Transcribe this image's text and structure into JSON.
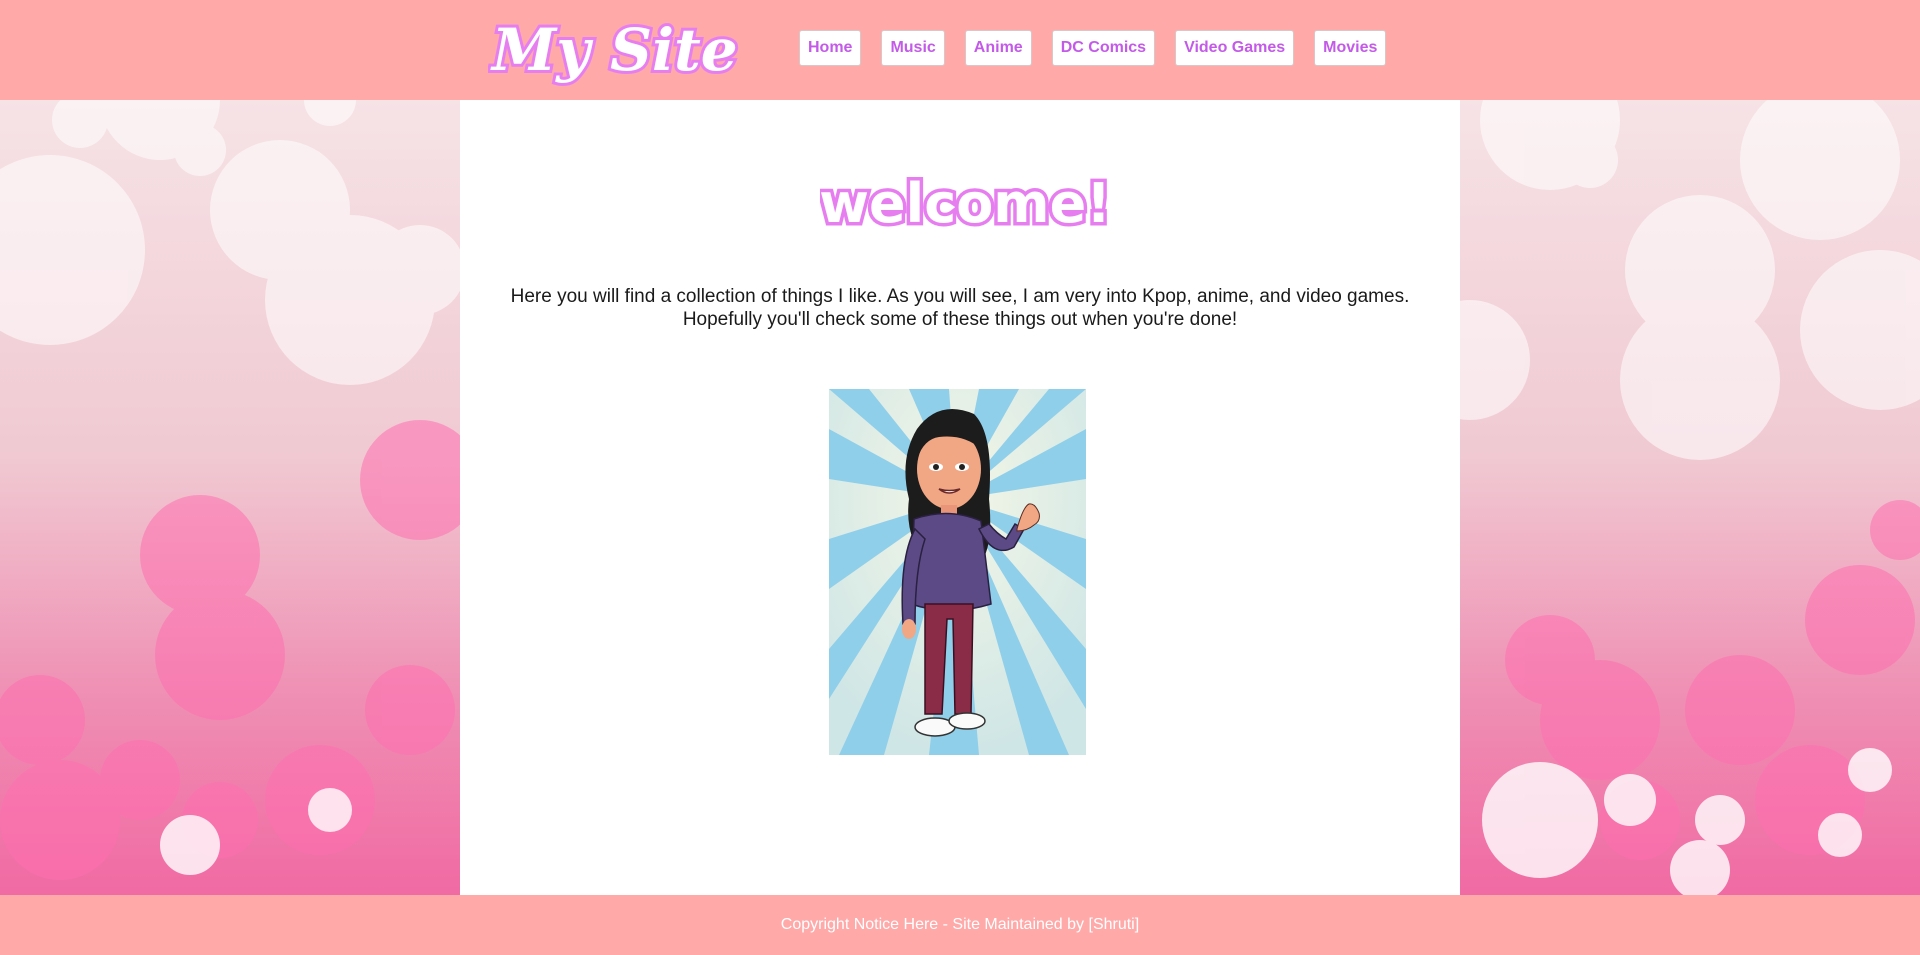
{
  "header": {
    "logo_text": "My Site",
    "nav": [
      {
        "label": "Home"
      },
      {
        "label": "Music"
      },
      {
        "label": "Anime"
      },
      {
        "label": "DC Comics"
      },
      {
        "label": "Video Games"
      },
      {
        "label": "Movies"
      }
    ]
  },
  "main": {
    "welcome_text": "welcome!",
    "intro_line1": "Here you will find a collection of things I like. As you will see, I am very into Kpop, anime, and video games.",
    "intro_line2": "Hopefully you'll check some of these things out when you're done!",
    "avatar_icon": "bitmoji-avatar-waving"
  },
  "footer": {
    "text": "Copyright Notice Here - Site Maintained by [Shruti]"
  },
  "colors": {
    "header_bg": "#ffa9a9",
    "nav_text": "#c35ae8",
    "content_bg": "#ffffff",
    "footer_text": "#ffffff",
    "logo_glow": "#e77ef0"
  }
}
